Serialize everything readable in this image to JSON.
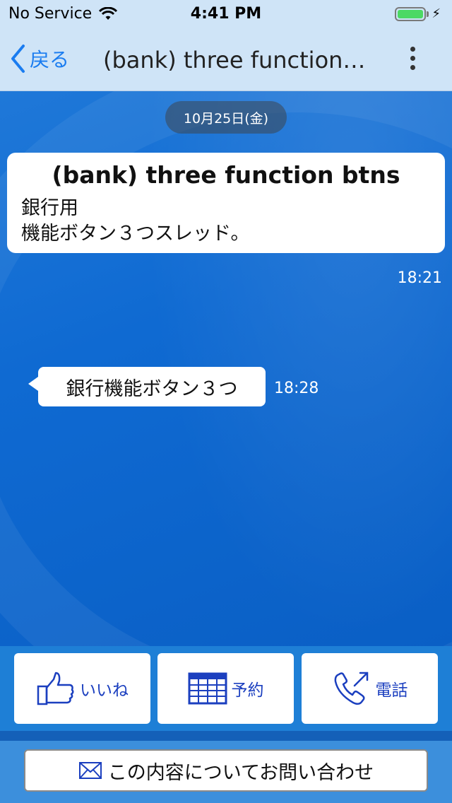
{
  "status": {
    "carrier": "No Service",
    "time": "4:41 PM",
    "battery_color": "#4cd964"
  },
  "nav": {
    "back_label": "戻る",
    "title": "(bank) three function…",
    "more_icon": "more-vertical-icon"
  },
  "chat": {
    "date": "10月25日(金)",
    "card": {
      "title": "(bank) three function btns",
      "body_line1": "銀行用",
      "body_line2": "機能ボタン３つスレッド。",
      "time": "18:21"
    },
    "bubble": {
      "text": "銀行機能ボタン３つ",
      "time": "18:28"
    }
  },
  "functions": [
    {
      "label": "いいね",
      "icon": "thumbs-up-icon"
    },
    {
      "label": "予約",
      "icon": "calendar-grid-icon"
    },
    {
      "label": "電話",
      "icon": "phone-icon"
    }
  ],
  "inquiry": {
    "label": "この内容についてお問い合わせ",
    "icon": "mail-icon"
  },
  "colors": {
    "accent": "#1a7cf0",
    "function_text": "#1b3fbf",
    "background": "#0a63c9"
  }
}
